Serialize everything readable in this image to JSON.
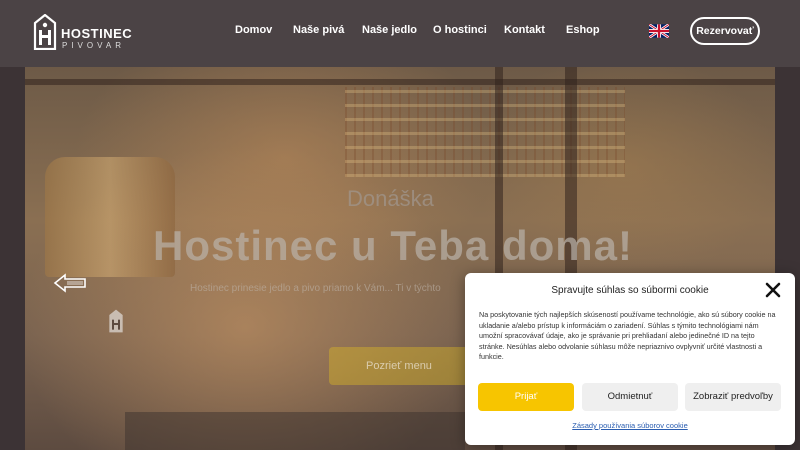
{
  "brand": {
    "name": "HOSTINEC",
    "sub": "PIVOVAR"
  },
  "nav": {
    "items": [
      "Domov",
      "Naše pivá",
      "Naše jedlo",
      "O hostinci",
      "Kontakt",
      "Eshop"
    ]
  },
  "header": {
    "language_icon": "uk-flag-icon",
    "reserve_label": "Rezervovať"
  },
  "hero": {
    "kicker": "Donáška",
    "title": "Hostinec u Teba doma!",
    "text": "Hostinec prinesie jedlo a pivo priamo k Vám... Ti v týchto",
    "cta_label": "Pozrieť menu",
    "prev_icon": "arrow-left-icon"
  },
  "cookie": {
    "title": "Spravujte súhlas so súbormi cookie",
    "text": "Na poskytovanie tých najlepších skúseností používame technológie, ako sú súbory cookie na ukladanie a/alebo prístup k informáciám o zariadení. Súhlas s týmito technológiami nám umožní spracovávať údaje, ako je správanie pri prehliadaní alebo jedinečné ID na tejto stránke. Nesúhlas alebo odvolanie súhlasu môže nepriaznivo ovplyvniť určité vlastnosti a funkcie.",
    "accept_label": "Prijať",
    "reject_label": "Odmietnuť",
    "prefs_label": "Zobraziť predvoľby",
    "policy_link": "Zásady používania súborov cookie",
    "close_icon": "close-icon"
  },
  "colors": {
    "header_bg": "#4b4345",
    "accent_yellow": "#f7c500",
    "link_blue": "#2a5db0"
  }
}
